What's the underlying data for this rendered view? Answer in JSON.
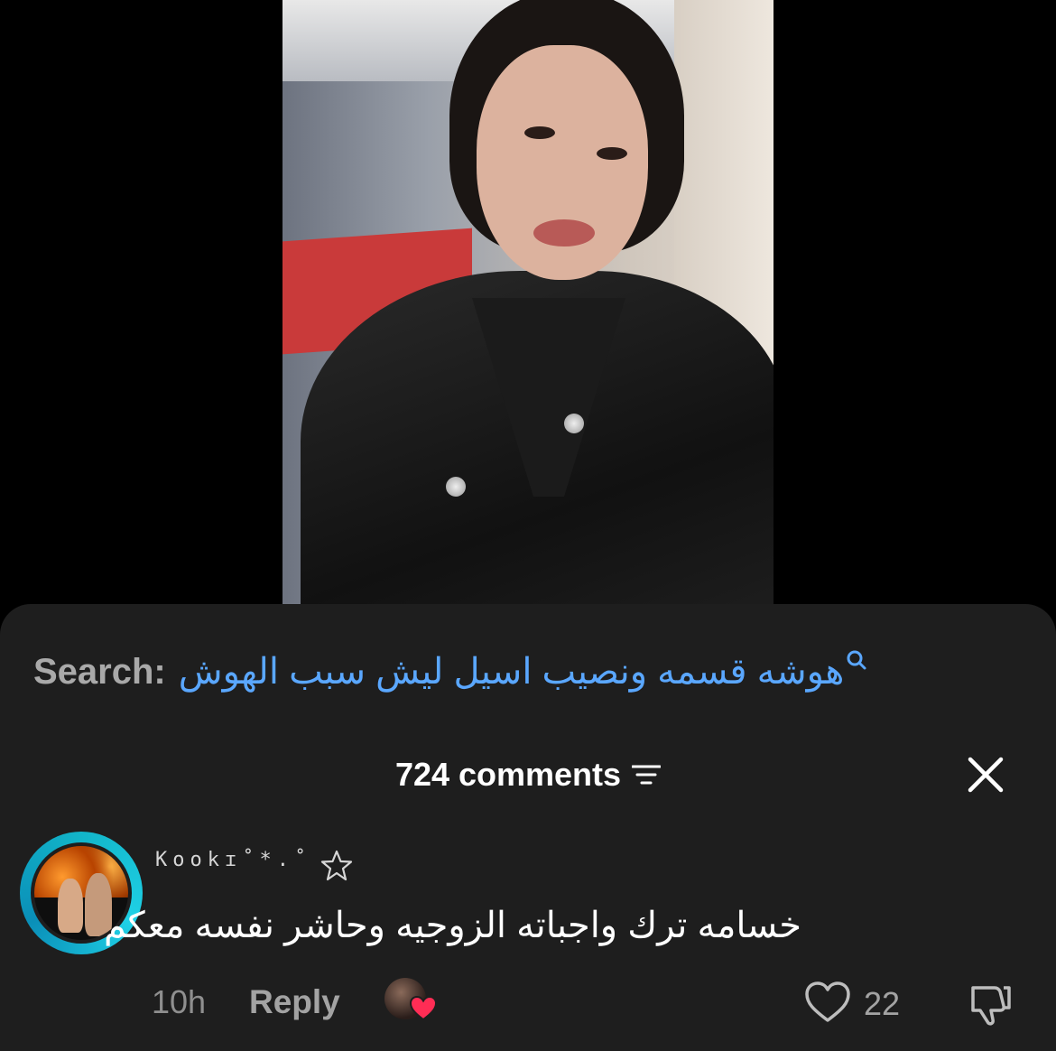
{
  "search": {
    "label": "Search:",
    "term": "هوشه قسمه ونصيب اسيل ليش سبب الهوش",
    "icon": "search-icon"
  },
  "comments_header": {
    "count_label": "724 comments",
    "filter_icon": "filter-icon",
    "close_icon": "close-icon"
  },
  "comment": {
    "username": "Kookɪ˚*.˚",
    "badge_icon": "star-outline-icon",
    "text": "خسامه ترك واجباته الزوجيه وحاشر نفسه معكم",
    "time": "10h",
    "reply_label": "Reply",
    "like_count": "22",
    "liked_by_creator": true
  },
  "colors": {
    "sheet_bg": "#1e1e1e",
    "search_accent": "#5aa7ff",
    "avatar_ring": "#12b5c9",
    "heart_red": "#ff2d55"
  }
}
